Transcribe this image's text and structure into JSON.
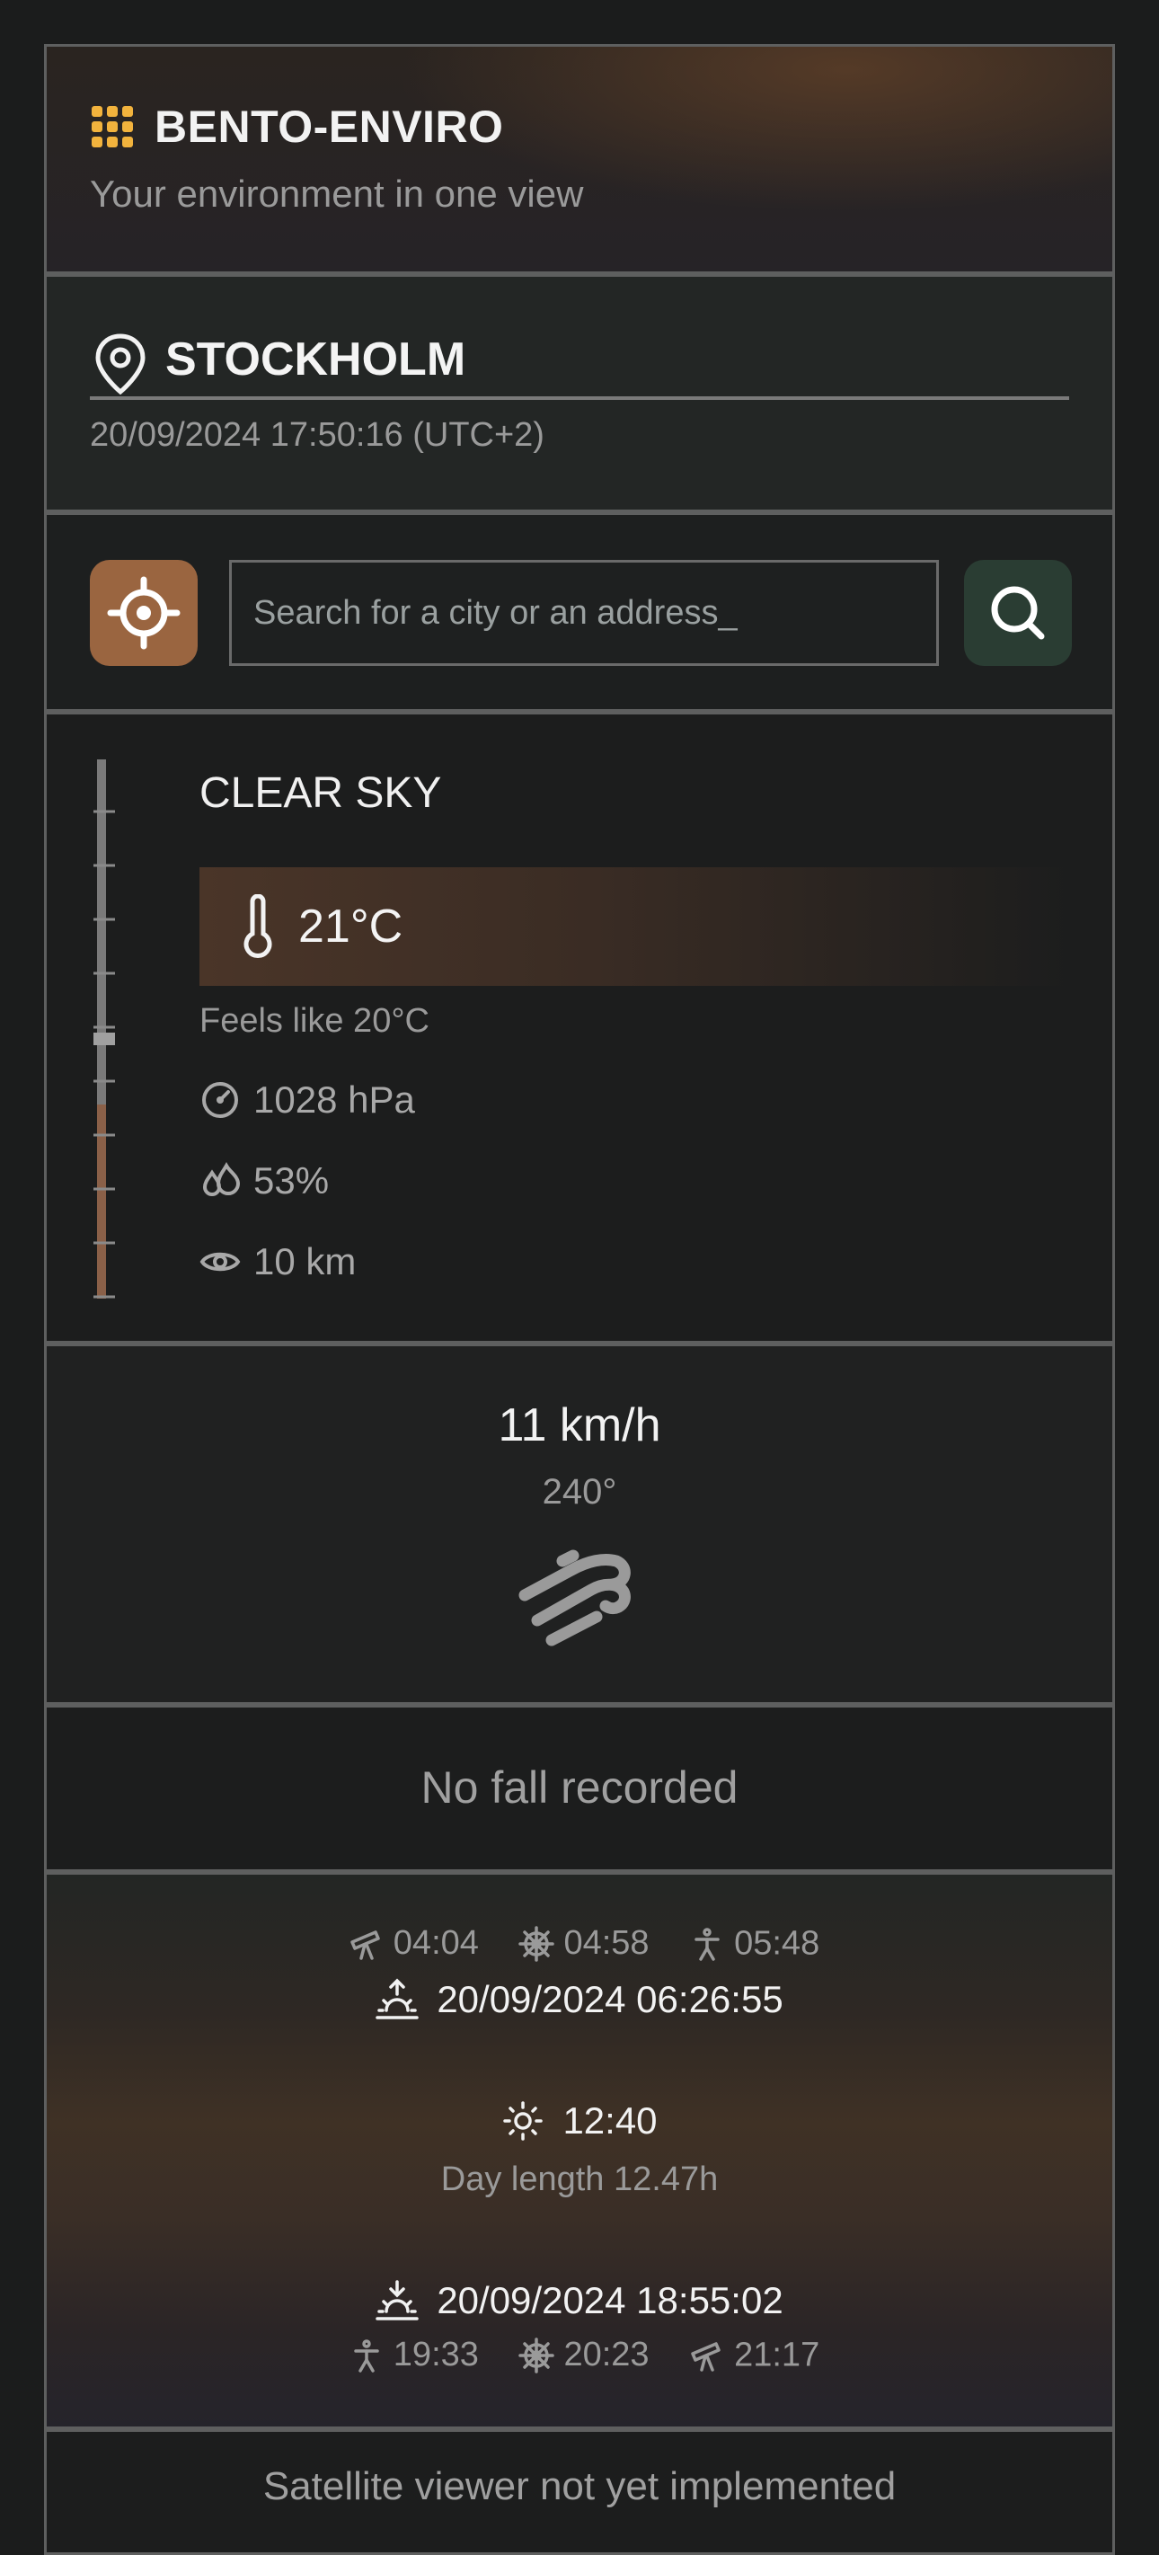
{
  "app": {
    "name": "BENTO-ENVIRO",
    "tagline": "Your environment in one view",
    "accent": "#f2b33d"
  },
  "location": {
    "city": "STOCKHOLM",
    "datetime": "20/09/2024 17:50:16 (UTC+2)"
  },
  "search": {
    "placeholder": "Search for a city or an address_",
    "locate_color": "#9a6540",
    "search_color": "#2a3d33"
  },
  "weather": {
    "condition": "CLEAR SKY",
    "temperature": "21°C",
    "feels_like": "Feels like 20°C",
    "pressure": "1028 hPa",
    "humidity": "53%",
    "visibility": "10 km",
    "scale_level": 0.56
  },
  "wind": {
    "speed": "11 km/h",
    "direction": "240°"
  },
  "precipitation": {
    "text": "No fall recorded"
  },
  "sun": {
    "morning_twilight": {
      "astronomical": "04:04",
      "nautical": "04:58",
      "civil": "05:48"
    },
    "sunrise": "20/09/2024 06:26:55",
    "solar_noon": "12:40",
    "day_length": "Day length 12.47h",
    "sunset": "20/09/2024 18:55:02",
    "evening_twilight": {
      "civil": "19:33",
      "nautical": "20:23",
      "astronomical": "21:17"
    }
  },
  "satellite": {
    "text": "Satellite viewer not yet implemented"
  }
}
